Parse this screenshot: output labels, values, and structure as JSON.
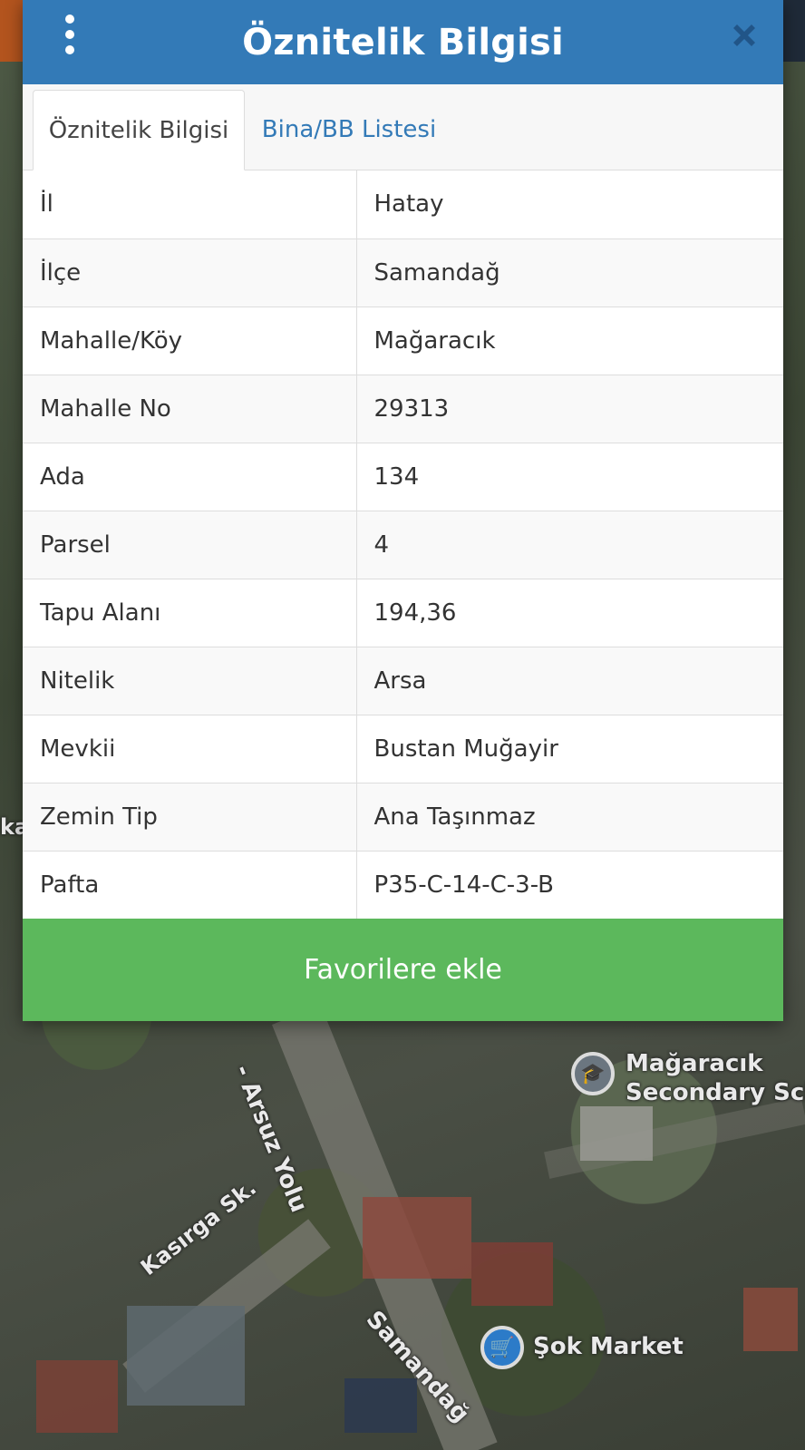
{
  "dialog": {
    "title": "Öznitelik Bilgisi",
    "menu_icon": "more-vertical-icon",
    "close_icon": "close-icon",
    "header_color": "#337ab7"
  },
  "tabs": [
    {
      "label": "Öznitelik Bilgisi",
      "active": true
    },
    {
      "label": "Bina/BB Listesi",
      "active": false
    }
  ],
  "attributes": [
    {
      "key": "İl",
      "value": "Hatay"
    },
    {
      "key": "İlçe",
      "value": "Samandağ"
    },
    {
      "key": "Mahalle/Köy",
      "value": "Mağaracık"
    },
    {
      "key": "Mahalle No",
      "value": "29313"
    },
    {
      "key": "Ada",
      "value": "134"
    },
    {
      "key": "Parsel",
      "value": "4"
    },
    {
      "key": "Tapu Alanı",
      "value": "194,36"
    },
    {
      "key": "Nitelik",
      "value": "Arsa"
    },
    {
      "key": "Mevkii",
      "value": "Bustan Muğayir"
    },
    {
      "key": "Zemin Tip",
      "value": "Ana Taşınmaz"
    },
    {
      "key": "Pafta",
      "value": "P35-C-14-C-3-B"
    }
  ],
  "favorite_button": {
    "label": "Favorilere ekle",
    "color": "#5cb85c"
  },
  "map": {
    "labels": {
      "school": "Mağaracık",
      "school_line2": "Secondary Sch",
      "road_arsuz": "- Arsuz Yolu",
      "road_kasirga": "Kasırga Sk.",
      "road_samandag": "Samandağ",
      "market": "Şok Market",
      "edge_fragment": "ka"
    },
    "school_icon": "school-icon",
    "market_icon": "shopping-cart-icon"
  }
}
